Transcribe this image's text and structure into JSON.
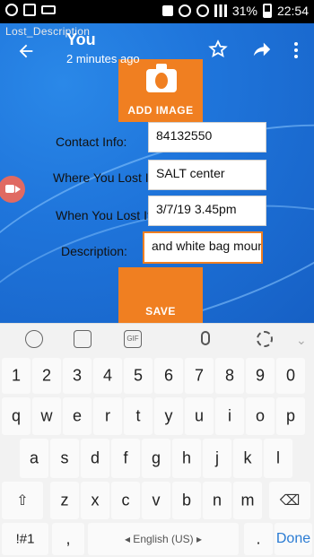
{
  "status_bar": {
    "battery_text": "31%",
    "time": "22:54"
  },
  "activity_label": "Lost_Description",
  "app_bar": {
    "title": "You",
    "subtitle": "2 minutes ago"
  },
  "add_image_label": "ADD IMAGE",
  "form": {
    "contact_label": "Contact Info:",
    "contact_value": "84132550",
    "where_label": "Where You Lost It:",
    "where_value": "SALT center",
    "when_label": "When You Lost It:",
    "when_value": "3/7/19 3.45pm",
    "desc_label": "Description:",
    "desc_value": "and white bag mount"
  },
  "save_label": "SAVE",
  "keyboard": {
    "row1": [
      "1",
      "2",
      "3",
      "4",
      "5",
      "6",
      "7",
      "8",
      "9",
      "0"
    ],
    "row2": [
      "q",
      "w",
      "e",
      "r",
      "t",
      "y",
      "u",
      "i",
      "o",
      "p"
    ],
    "row3": [
      "a",
      "s",
      "d",
      "f",
      "g",
      "h",
      "j",
      "k",
      "l"
    ],
    "row4": [
      "z",
      "x",
      "c",
      "v",
      "b",
      "n",
      "m"
    ],
    "symbols_label": "!#1",
    "comma_label": ",",
    "space_label": "◂ English (US) ▸",
    "period_label": ".",
    "done_label": "Done",
    "shift_icon": "⇧",
    "backspace_icon": "⌫",
    "gif_label": "GIF",
    "chevron": "⌄"
  }
}
